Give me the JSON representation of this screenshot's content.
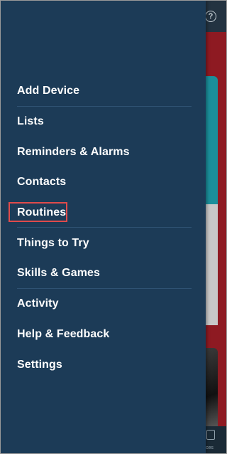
{
  "menu": {
    "items": [
      {
        "label": "Add Device"
      },
      {
        "label": "Lists"
      },
      {
        "label": "Reminders & Alarms"
      },
      {
        "label": "Contacts"
      },
      {
        "label": "Routines"
      },
      {
        "label": "Things to Try"
      },
      {
        "label": "Skills & Games"
      },
      {
        "label": "Activity"
      },
      {
        "label": "Help & Feedback"
      },
      {
        "label": "Settings"
      }
    ]
  },
  "background": {
    "help_icon_glyph": "?",
    "bottom_tab_label": "ces"
  },
  "colors": {
    "drawer": "#1c3b57",
    "divider": "#2f5273",
    "highlight": "#e04b4b",
    "text": "#ffffff"
  }
}
